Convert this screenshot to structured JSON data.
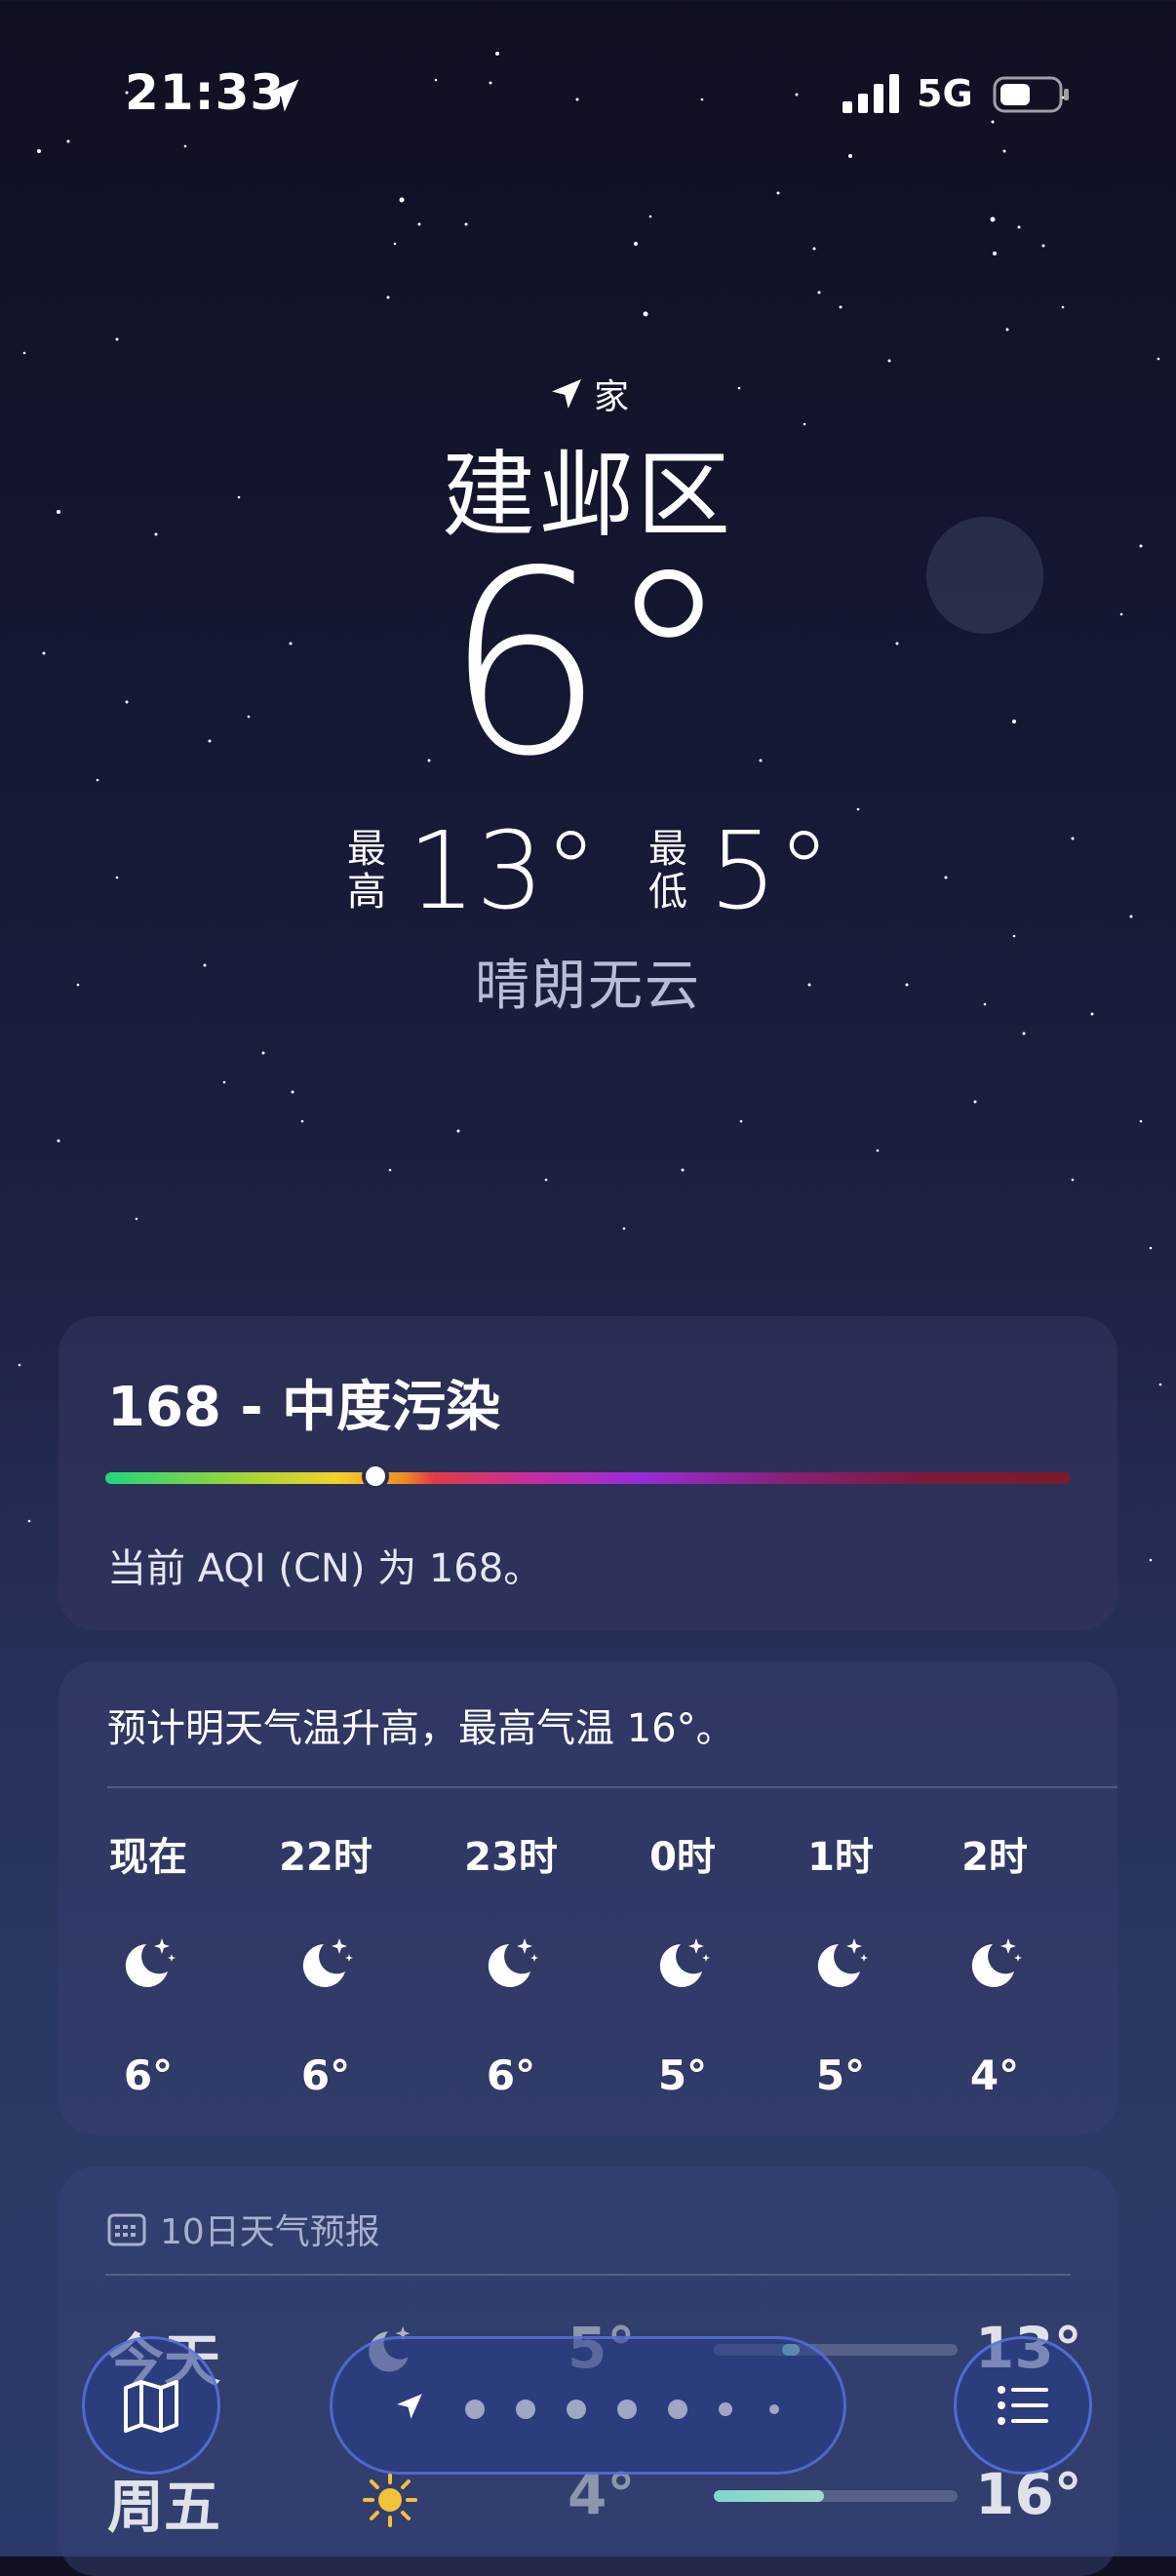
{
  "status_bar": {
    "time": "21:33",
    "network": "5G",
    "icons": [
      "location-arrow-icon",
      "signal-icon",
      "battery-icon"
    ]
  },
  "location": {
    "tag": "家",
    "city": "建邺区"
  },
  "current": {
    "temperature": "6°",
    "high_label": "最高",
    "high": "13°",
    "low_label": "最低",
    "low": "5°",
    "condition": "晴朗无云"
  },
  "aqi": {
    "title": "168 - 中度污染",
    "description": "当前 AQI (CN) 为 168。",
    "value": 168,
    "indicator_fraction": 0.27
  },
  "hourly": {
    "summary": "预计明天气温升高，最高气温 16°。",
    "items": [
      {
        "label": "现在",
        "temp": "6°",
        "icon": "clear-night-icon"
      },
      {
        "label": "22时",
        "temp": "6°",
        "icon": "clear-night-icon"
      },
      {
        "label": "23时",
        "temp": "6°",
        "icon": "clear-night-icon"
      },
      {
        "label": "0时",
        "temp": "5°",
        "icon": "clear-night-icon"
      },
      {
        "label": "1时",
        "temp": "5°",
        "icon": "clear-night-icon"
      },
      {
        "label": "2时",
        "temp": "4°",
        "icon": "clear-night-icon"
      }
    ]
  },
  "daily": {
    "header": "10日天气预报",
    "rows": [
      {
        "day": "今天",
        "icon": "clear-night-icon",
        "low": "5°",
        "high": "13°",
        "range_start": 0.28,
        "range_end": 0.35
      },
      {
        "day": "周五",
        "icon": "sun-icon",
        "low": "4°",
        "high": "16°",
        "range_start": 0.0,
        "range_end": 0.45
      }
    ]
  },
  "toolbar": {
    "page_count": 7,
    "current_page": 0
  },
  "colors": {
    "aqi_gradient": [
      "#20d67a",
      "#f2d22a",
      "#e33b43",
      "#9b2bd9",
      "#7a1a2a"
    ]
  }
}
